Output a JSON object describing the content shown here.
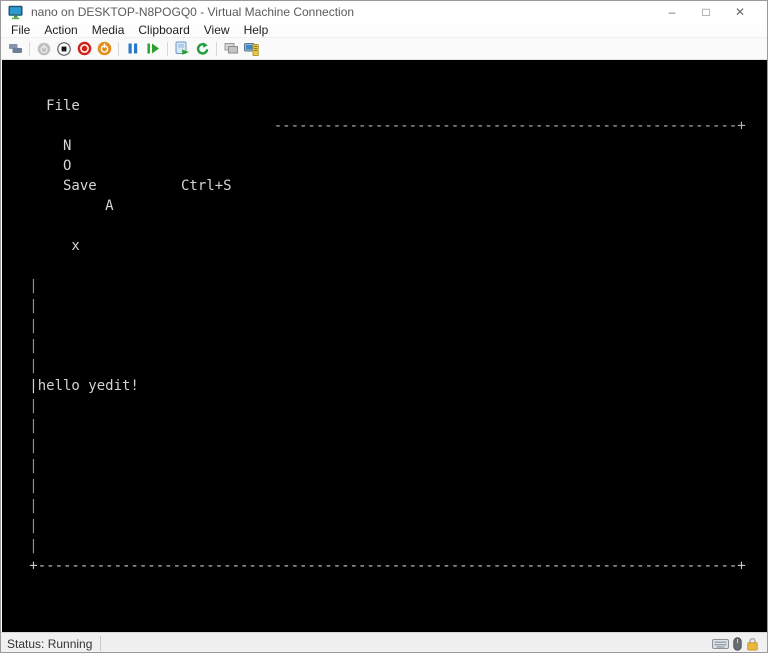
{
  "window": {
    "title": "nano on DESKTOP-N8POGQ0 - Virtual Machine Connection",
    "controls": [
      {
        "name": "minimize",
        "glyph": "–"
      },
      {
        "name": "maximize",
        "glyph": "□"
      },
      {
        "name": "close",
        "glyph": "✕"
      }
    ]
  },
  "menubar": {
    "items": [
      "File",
      "Action",
      "Media",
      "Clipboard",
      "View",
      "Help"
    ]
  },
  "toolbar": {
    "icons": [
      "ctrl-alt-del-icon",
      "start-icon",
      "turn-off-icon",
      "shut-down-icon",
      "save-state-icon",
      "pause-icon",
      "reset-icon",
      "checkpoint-icon",
      "revert-icon",
      "share-icon",
      "enhanced-session-icon"
    ]
  },
  "console": {
    "background": "#000000",
    "lines": [
      {
        "t": "",
        "c": "#d6d6d6"
      },
      {
        "t": "",
        "c": "#d6d6d6"
      },
      {
        "t": "     File",
        "c": "#d6d6d6"
      },
      {
        "t": "                                -------------------------------------------------------+",
        "c": "#b4b4b4"
      },
      {
        "t": "       N",
        "c": "#d6d6d6"
      },
      {
        "t": "       O",
        "c": "#d6d6d6"
      },
      {
        "t": "       Save          Ctrl+S",
        "c": "#d6d6d6"
      },
      {
        "t": "            A",
        "c": "#d6d6d6"
      },
      {
        "t": "",
        "c": "#d6d6d6"
      },
      {
        "t": "        x",
        "c": "#d6d6d6"
      },
      {
        "t": "",
        "c": "#d6d6d6"
      },
      {
        "t": "   |",
        "c": "#909090"
      },
      {
        "t": "   |",
        "c": "#909090"
      },
      {
        "t": "   |",
        "c": "#909090"
      },
      {
        "t": "   |",
        "c": "#909090"
      },
      {
        "t": "   |",
        "c": "#909090"
      },
      {
        "t": "   |hello yedit!",
        "c": "#d2d2d2"
      },
      {
        "t": "   |",
        "c": "#909090"
      },
      {
        "t": "   |",
        "c": "#909090"
      },
      {
        "t": "   |",
        "c": "#909090"
      },
      {
        "t": "   |",
        "c": "#909090"
      },
      {
        "t": "   |",
        "c": "#909090"
      },
      {
        "t": "   |",
        "c": "#909090"
      },
      {
        "t": "   |",
        "c": "#909090"
      },
      {
        "t": "   |",
        "c": "#909090"
      },
      {
        "t": "   +-----------------------------------------------------------------------------------+",
        "c": "#c6c6c6"
      }
    ]
  },
  "statusbar": {
    "status": "Status: Running",
    "icons": [
      "keyboard-icon",
      "mouse-icon",
      "lock-icon"
    ]
  }
}
